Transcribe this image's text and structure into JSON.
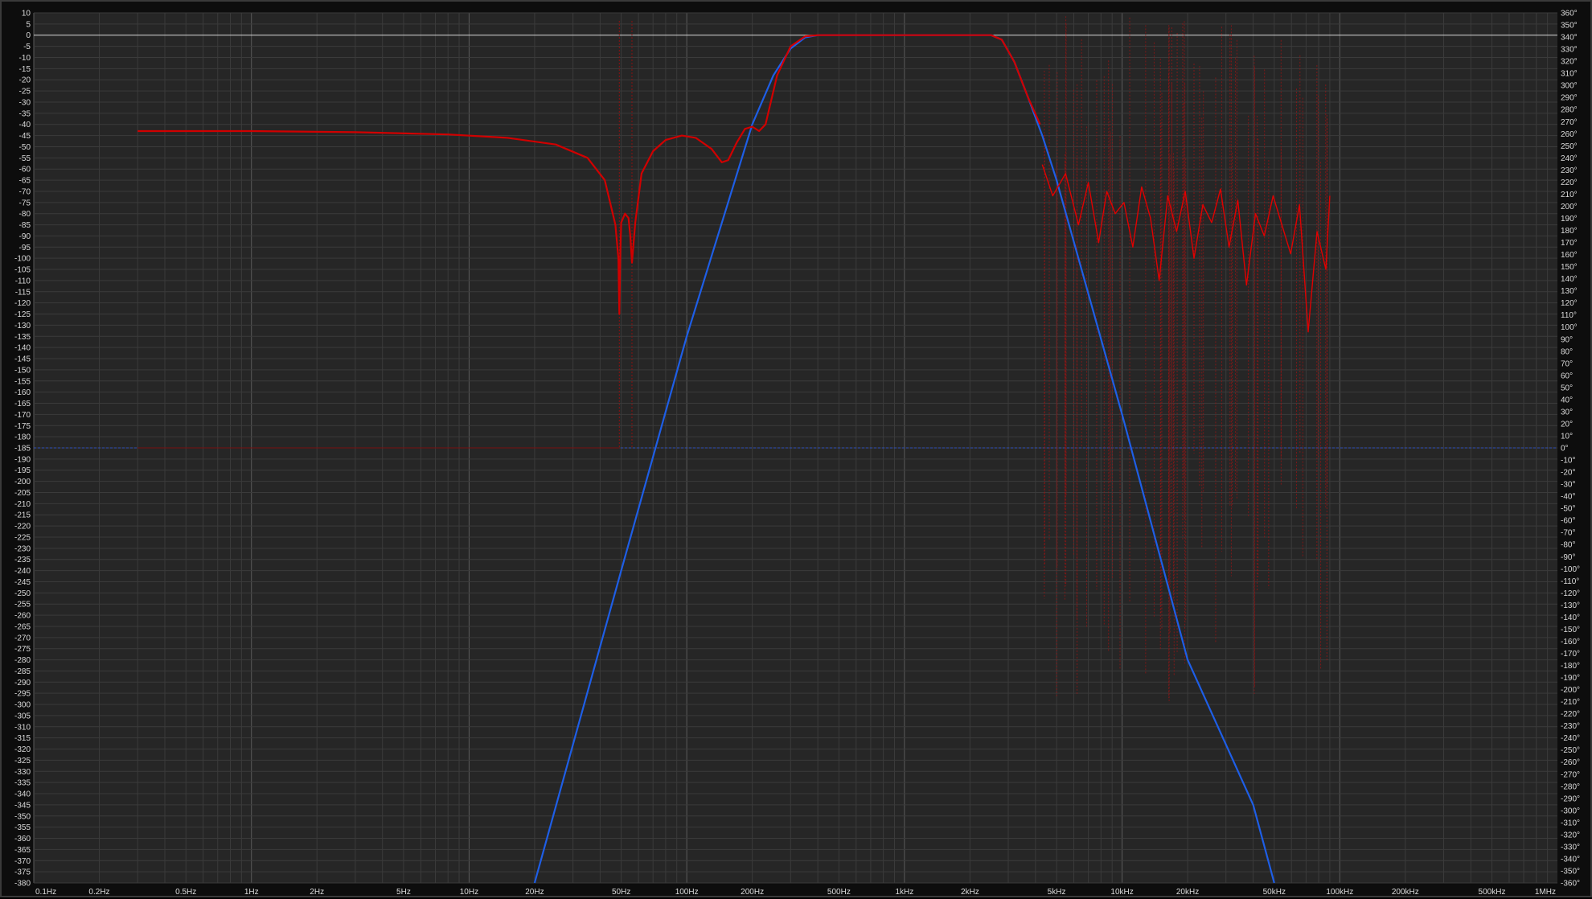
{
  "chart_data": {
    "type": "line",
    "title": "",
    "xlabel": "",
    "ylabel": "",
    "x_scale": "log",
    "xlim": [
      0.1,
      1000000
    ],
    "ylim": [
      -380,
      10
    ],
    "y2lim": [
      -360,
      360
    ],
    "grid": true,
    "legend": "none",
    "x_ticks": [
      {
        "value": 0.1,
        "label": "0.1Hz"
      },
      {
        "value": 0.2,
        "label": "0.2Hz"
      },
      {
        "value": 0.5,
        "label": "0.5Hz"
      },
      {
        "value": 1,
        "label": "1Hz"
      },
      {
        "value": 2,
        "label": "2Hz"
      },
      {
        "value": 5,
        "label": "5Hz"
      },
      {
        "value": 10,
        "label": "10Hz"
      },
      {
        "value": 20,
        "label": "20Hz"
      },
      {
        "value": 50,
        "label": "50Hz"
      },
      {
        "value": 100,
        "label": "100Hz"
      },
      {
        "value": 200,
        "label": "200Hz"
      },
      {
        "value": 500,
        "label": "500Hz"
      },
      {
        "value": 1000,
        "label": "1kHz"
      },
      {
        "value": 2000,
        "label": "2kHz"
      },
      {
        "value": 5000,
        "label": "5kHz"
      },
      {
        "value": 10000,
        "label": "10kHz"
      },
      {
        "value": 20000,
        "label": "20kHz"
      },
      {
        "value": 50000,
        "label": "50kHz"
      },
      {
        "value": 100000,
        "label": "100kHz"
      },
      {
        "value": 200000,
        "label": "200kHz"
      },
      {
        "value": 500000,
        "label": "500kHz"
      },
      {
        "value": 1000000,
        "label": "1MHz"
      }
    ],
    "y_ticks": [
      10,
      5,
      0,
      -5,
      -10,
      -15,
      -20,
      -25,
      -30,
      -35,
      -40,
      -45,
      -50,
      -55,
      -60,
      -65,
      -70,
      -75,
      -80,
      -85,
      -90,
      -95,
      -100,
      -105,
      -110,
      -115,
      -120,
      -125,
      -130,
      -135,
      -140,
      -145,
      -150,
      -155,
      -160,
      -165,
      -170,
      -175,
      -180,
      -185,
      -190,
      -195,
      -200,
      -205,
      -210,
      -215,
      -220,
      -225,
      -230,
      -235,
      -240,
      -245,
      -250,
      -255,
      -260,
      -265,
      -270,
      -275,
      -280,
      -285,
      -290,
      -295,
      -300,
      -305,
      -310,
      -315,
      -320,
      -325,
      -330,
      -335,
      -340,
      -345,
      -350,
      -355,
      -360,
      -365,
      -370,
      -375,
      -380
    ],
    "y2_ticks": [
      "360°",
      "350°",
      "340°",
      "330°",
      "320°",
      "310°",
      "300°",
      "290°",
      "280°",
      "270°",
      "260°",
      "250°",
      "240°",
      "230°",
      "220°",
      "210°",
      "200°",
      "190°",
      "180°",
      "170°",
      "160°",
      "150°",
      "140°",
      "130°",
      "120°",
      "110°",
      "100°",
      "90°",
      "80°",
      "70°",
      "60°",
      "50°",
      "40°",
      "30°",
      "20°",
      "10°",
      "0°",
      "-10°",
      "-20°",
      "-30°",
      "-40°",
      "-50°",
      "-60°",
      "-70°",
      "-80°",
      "-90°",
      "-100°",
      "-110°",
      "-120°",
      "-130°",
      "-140°",
      "-150°",
      "-160°",
      "-170°",
      "-180°",
      "-190°",
      "-200°",
      "-210°",
      "-220°",
      "-230°",
      "-240°",
      "-250°",
      "-260°",
      "-270°",
      "-280°",
      "-290°",
      "-300°",
      "-310°",
      "-320°",
      "-330°",
      "-340°",
      "-350°",
      "-360°"
    ],
    "series": [
      {
        "color": "#1e5ee6",
        "x": [
          20,
          50,
          100,
          200,
          250,
          300,
          350,
          400,
          2500,
          2800,
          3200,
          3700,
          4300,
          5000,
          10000,
          20000,
          40000,
          50000
        ],
        "y": [
          -380,
          -240,
          -135,
          -40,
          -18,
          -6,
          -1,
          0,
          0,
          -2,
          -12,
          -28,
          -45,
          -65,
          -170,
          -280,
          -345,
          -380
        ]
      },
      {
        "color": "#d00000",
        "x": [
          0.3,
          1,
          3,
          8,
          15,
          25,
          35,
          42,
          47,
          48.5,
          49,
          49.5,
          50,
          52,
          54,
          55,
          56,
          58,
          62,
          70,
          80,
          95,
          110,
          130,
          145,
          155,
          170,
          185,
          200,
          215,
          230,
          260,
          300,
          350,
          400,
          2500,
          2800,
          3200,
          3700,
          4200
        ],
        "y": [
          -43,
          -43,
          -43.5,
          -44.5,
          -46,
          -49,
          -55,
          -65,
          -85,
          -100,
          -125,
          -98,
          -84,
          -80,
          -82,
          -90,
          -102,
          -84,
          -62,
          -52,
          -47,
          -45,
          -46,
          -51,
          -57,
          -56,
          -48,
          -42,
          -41,
          -43,
          -40,
          -18,
          -5,
          -0.5,
          0,
          0,
          -2,
          -12,
          -28,
          -40
        ]
      },
      {
        "color": "#e00000",
        "x": [
          4300,
          4800,
          5500,
          6300,
          7000,
          7800,
          8500,
          9300,
          10200,
          11200,
          12300,
          13500,
          14800,
          16200,
          17800,
          19500,
          21400,
          23500,
          25800,
          28300,
          31000,
          34000,
          37300,
          41000,
          45000,
          49400,
          54200,
          59500,
          65300,
          71600,
          78600,
          86300,
          90000
        ],
        "y": [
          -58,
          -72,
          -62,
          -85,
          -66,
          -93,
          -70,
          -80,
          -75,
          -95,
          -68,
          -82,
          -110,
          -72,
          -88,
          -70,
          -100,
          -76,
          -84,
          -69,
          -95,
          -74,
          -112,
          -80,
          -90,
          -72,
          -85,
          -98,
          -76,
          -133,
          -88,
          -105,
          -72
        ]
      }
    ]
  }
}
